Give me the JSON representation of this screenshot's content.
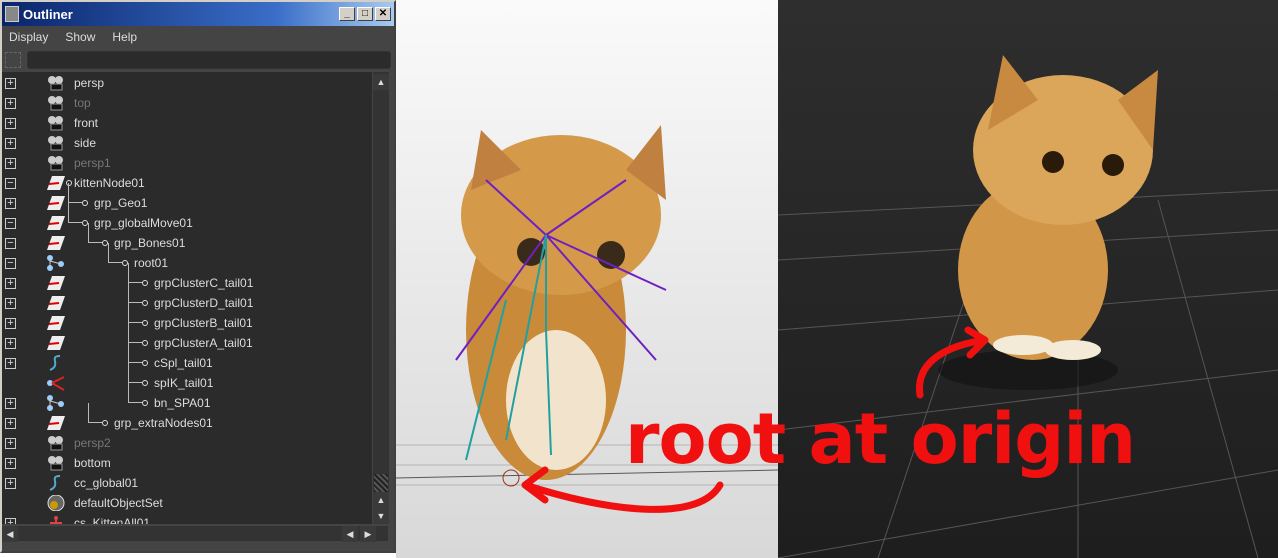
{
  "window": {
    "title": "Outliner"
  },
  "menu": [
    "Display",
    "Show",
    "Help"
  ],
  "rows": [
    {
      "name": "persp",
      "exp": "+",
      "icon": "camera",
      "lvl": 0,
      "dim": false
    },
    {
      "name": "top",
      "exp": "+",
      "icon": "camera",
      "lvl": 0,
      "dim": true
    },
    {
      "name": "front",
      "exp": "+",
      "icon": "camera",
      "lvl": 0,
      "dim": false
    },
    {
      "name": "side",
      "exp": "+",
      "icon": "camera",
      "lvl": 0,
      "dim": false
    },
    {
      "name": "persp1",
      "exp": "+",
      "icon": "camera",
      "lvl": 0,
      "dim": true
    },
    {
      "name": "kittenNode01",
      "exp": "-",
      "icon": "transform",
      "lvl": 0,
      "dim": false,
      "node": true
    },
    {
      "name": "grp_Geo1",
      "exp": "+",
      "icon": "transform",
      "lvl": 1,
      "dim": false
    },
    {
      "name": "grp_globalMove01",
      "exp": "-",
      "icon": "transform",
      "lvl": 1,
      "dim": false
    },
    {
      "name": "grp_Bones01",
      "exp": "-",
      "icon": "transform",
      "lvl": 2,
      "dim": false
    },
    {
      "name": "root01",
      "exp": "-",
      "icon": "joint",
      "lvl": 3,
      "dim": false
    },
    {
      "name": "grpClusterC_tail01",
      "exp": "+",
      "icon": "transform",
      "lvl": 4,
      "dim": false
    },
    {
      "name": "grpClusterD_tail01",
      "exp": "+",
      "icon": "transform",
      "lvl": 4,
      "dim": false
    },
    {
      "name": "grpClusterB_tail01",
      "exp": "+",
      "icon": "transform",
      "lvl": 4,
      "dim": false
    },
    {
      "name": "grpClusterA_tail01",
      "exp": "+",
      "icon": "transform",
      "lvl": 4,
      "dim": false
    },
    {
      "name": "cSpl_tail01",
      "exp": "+",
      "icon": "curve",
      "lvl": 4,
      "dim": false
    },
    {
      "name": "spIK_tail01",
      "exp": "",
      "icon": "ik-handle",
      "lvl": 4,
      "dim": false
    },
    {
      "name": "bn_SPA01",
      "exp": "+",
      "icon": "joint",
      "lvl": 4,
      "dim": false
    },
    {
      "name": "grp_extraNodes01",
      "exp": "+",
      "icon": "transform",
      "lvl": 2,
      "dim": false
    },
    {
      "name": "persp2",
      "exp": "+",
      "icon": "camera",
      "lvl": 0,
      "dim": true
    },
    {
      "name": "bottom",
      "exp": "+",
      "icon": "camera",
      "lvl": 0,
      "dim": false
    },
    {
      "name": "cc_global01",
      "exp": "+",
      "icon": "curve",
      "lvl": 0,
      "dim": false
    },
    {
      "name": "defaultObjectSet",
      "exp": "",
      "icon": "set",
      "lvl": 0,
      "dim": false
    },
    {
      "name": "cs_KittenAll01",
      "exp": "+",
      "icon": "character",
      "lvl": 0,
      "dim": false
    }
  ],
  "annotation": "root at origin",
  "colors": {
    "annotation": "#f01010",
    "titlebar": "#0a246a"
  }
}
